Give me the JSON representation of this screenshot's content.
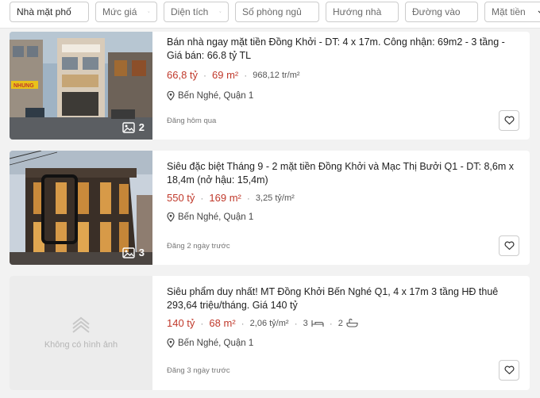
{
  "filters": [
    {
      "label": "Nhà mặt phố",
      "active": true
    },
    {
      "label": "Mức giá",
      "active": false
    },
    {
      "label": "Diện tích",
      "active": false
    },
    {
      "label": "Số phòng ngủ",
      "active": false
    },
    {
      "label": "Hướng nhà",
      "active": false
    },
    {
      "label": "Đường vào",
      "active": false
    },
    {
      "label": "Mặt tiền",
      "active": false
    }
  ],
  "listings": [
    {
      "title": "Bán nhà ngay mặt tiền Đồng Khởi - DT: 4 x 17m. Công nhận: 69m2 - 3 tầng - Giá bán: 66.8 tỷ TL",
      "price": "66,8 tỷ",
      "area": "69 m²",
      "price_per_m2": "968,12 tr/m²",
      "location": "Bến Nghé, Quận 1",
      "posted": "Đăng hôm qua",
      "image_count": "2",
      "sign_text": "NHUNG"
    },
    {
      "title": "Siêu đặc biệt Tháng 9 - 2 mặt tiền Đồng Khởi và Mạc Thị Bưởi Q1 - DT: 8,6m x 18,4m (nở hậu: 15,4m)",
      "price": "550 tỷ",
      "area": "169 m²",
      "price_per_m2": "3,25 tỷ/m²",
      "location": "Bến Nghé, Quận 1",
      "posted": "Đăng 2 ngày trước",
      "image_count": "3"
    },
    {
      "title": "Siêu phẩm duy nhất! MT Đồng Khởi Bến Nghé Q1, 4 x 17m 3 tầng HĐ thuê 293,64 triệu/tháng. Giá 140 tỷ",
      "price": "140 tỷ",
      "area": "68 m²",
      "price_per_m2": "2,06 tỷ/m²",
      "bedrooms": "3",
      "bathrooms": "2",
      "location": "Bến Nghé, Quận 1",
      "posted": "Đăng 3 ngày trước",
      "no_image_text": "Không có hình ảnh"
    }
  ],
  "icons": {
    "chevron": "chevron-down-icon",
    "gallery": "image-icon",
    "location": "location-pin-icon",
    "favorite": "heart-icon",
    "bed": "bed-icon",
    "bath": "bathtub-icon"
  },
  "colors": {
    "price": "#c0392b",
    "background": "#f2f2f2",
    "card": "#ffffff"
  }
}
